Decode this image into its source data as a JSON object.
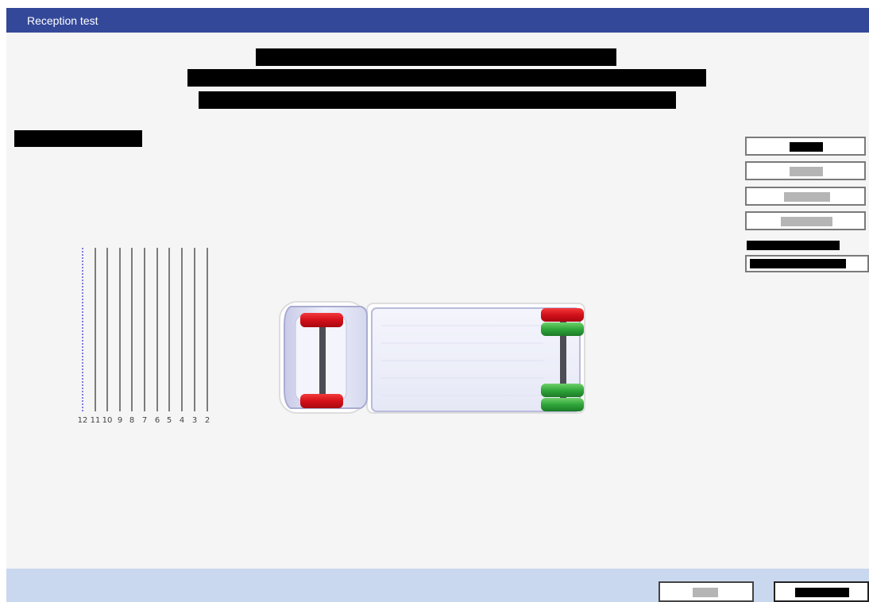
{
  "window": {
    "title": "Reception test"
  },
  "scale": {
    "labels": [
      "12",
      "11",
      "10",
      "9",
      "8",
      "7",
      "6",
      "5",
      "4",
      "3",
      "2"
    ],
    "active_indicator": "12"
  },
  "vehicle": {
    "front_axle_color": "#d9141b",
    "rear_axle_colors": [
      "#d9141b",
      "#2fa63a",
      "#2fa63a",
      "#2fa63a"
    ]
  },
  "colors": {
    "title_bar": "#34489a",
    "footer": "#c9d8ef",
    "background": "#f5f5f5"
  }
}
